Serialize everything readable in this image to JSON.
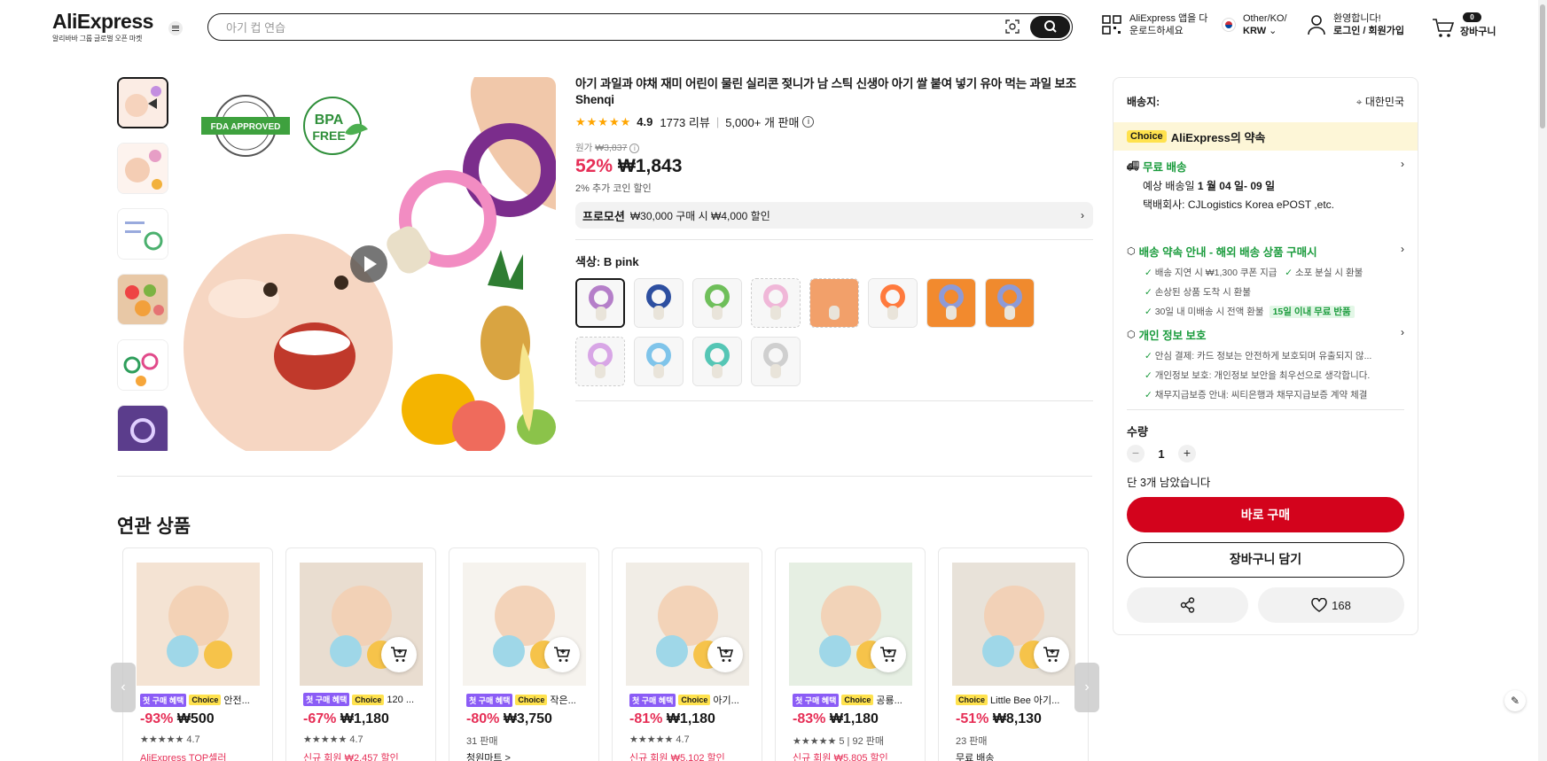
{
  "header": {
    "logo": "AliExpress",
    "logo_sub": "알리바바 그룹 글로벌 오픈 마켓",
    "search_placeholder": "아기 컵 연습",
    "app_line1": "AliExpress 앱을 다",
    "app_line2": "운로드하세요",
    "lang_line1": "Other/KO/",
    "lang_line2": "KRW",
    "acct_line1": "환영합니다!",
    "acct_line2": "로그인 / 회원가입",
    "cart_label": "장바구니",
    "cart_count": "0"
  },
  "product": {
    "title": "아기 과일과 야채 재미 어린이 물린 실리콘 젖니가 남 스틱 신생아 아기 쌀 붙여 넣기 유아 먹는 과일 보조 Shenqi",
    "rating": "4.9",
    "reviews": "1773 리뷰",
    "sold": "5,000+ 개 판매",
    "orig_label": "원가",
    "orig_price": "₩3,837",
    "discount": "52%",
    "price": "₩1,843",
    "coin": "2% 추가 코인 할인",
    "promo_label": "프로모션",
    "promo_text": "₩30,000 구매 시 ₩4,000 할인",
    "color_label": "색상: B pink",
    "swatches": [
      {
        "color": "#b57fc9",
        "state": "active"
      },
      {
        "color": "#2d4fa0",
        "state": ""
      },
      {
        "color": "#6fbf5a",
        "state": ""
      },
      {
        "color": "#f0b7d8",
        "state": "soldout"
      },
      {
        "color": "#f2a06a",
        "state": "soldout"
      },
      {
        "color": "#ff7a3d",
        "state": ""
      },
      {
        "color": "#f28a2e",
        "state": ""
      },
      {
        "color": "#f08a2e",
        "state": ""
      },
      {
        "color": "#d8a6e6",
        "state": "soldout"
      },
      {
        "color": "#7fc4ea",
        "state": ""
      },
      {
        "color": "#55c6b5",
        "state": ""
      },
      {
        "color": "#cfcfcf",
        "state": ""
      }
    ]
  },
  "panel": {
    "ship_label": "배송지:",
    "ship_dest": "대한민국",
    "choice_tag": "Choice",
    "choice_text": "AliExpress의 약속",
    "free_ship": "무료 배송",
    "eta_prefix": "예상 배송일",
    "eta": "1 월 04 일- 09 일",
    "carrier": "택배회사: CJLogistics Korea ePOST ,etc.",
    "promise_title": "배송 약속 안내 - 해외 배송 상품 구매시",
    "promise_1": "배송 지연 시 ₩1,300 쿠폰 지급",
    "promise_2": "소포 분실 시 환불",
    "promise_3": "손상된 상품 도착 시 환불",
    "promise_4": "30일 내 미배송 시 전액 환불",
    "promise_tag": "15일 이내 무료 반품",
    "privacy_title": "개인 정보 보호",
    "privacy_1": "안심 결제: 카드 정보는 안전하게 보호되며 유출되지 않...",
    "privacy_2": "개인정보 보호: 개인정보 보안을 최우선으로 생각합니다.",
    "privacy_3": "채무지급보증 안내: 씨티은행과 채무지급보증 계약 체결",
    "qty_label": "수량",
    "qty_value": "1",
    "stock": "단 3개 남았습니다",
    "buy_now": "바로 구매",
    "add_cart": "장바구니 담기",
    "wish_count": "168"
  },
  "related": {
    "title": "연관 상품",
    "items": [
      {
        "tags": [
          "첫 구매 혜택",
          "Choice"
        ],
        "name": "안전...",
        "discount": "-93%",
        "price": "₩500",
        "meta": "★★★★★ 4.7",
        "extra": "AliExpress TOP셀러",
        "img": "#f4e3d3"
      },
      {
        "tags": [
          "첫 구매 혜택",
          "Choice"
        ],
        "name": "120 ...",
        "discount": "-67%",
        "price": "₩1,180",
        "meta": "★★★★★ 4.7",
        "extra": "신규 회원 ₩2,457 할인",
        "img": "#e9ddd0"
      },
      {
        "tags": [
          "첫 구매 혜택",
          "Choice"
        ],
        "name": "작은...",
        "discount": "-80%",
        "price": "₩3,750",
        "meta": "31 판매",
        "extra": "청원마트 >",
        "img": "#f6f3ee"
      },
      {
        "tags": [
          "첫 구매 혜택",
          "Choice"
        ],
        "name": "아기...",
        "discount": "-81%",
        "price": "₩1,180",
        "meta": "★★★★★ 4.7",
        "extra": "신규 회원 ₩5,102 할인",
        "img": "#f1ede6"
      },
      {
        "tags": [
          "첫 구매 혜택",
          "Choice"
        ],
        "name": "공룡...",
        "discount": "-83%",
        "price": "₩1,180",
        "meta": "★★★★★ 5 | 92 판매",
        "extra": "신규 회원 ₩5,805 할인",
        "img": "#e6efe3"
      },
      {
        "tags": [
          "Choice"
        ],
        "name": "Little Bee 아기...",
        "discount": "-51%",
        "price": "₩8,130",
        "meta": "23 판매",
        "extra": "무료 배송",
        "img": "#e8e2d9"
      }
    ]
  }
}
